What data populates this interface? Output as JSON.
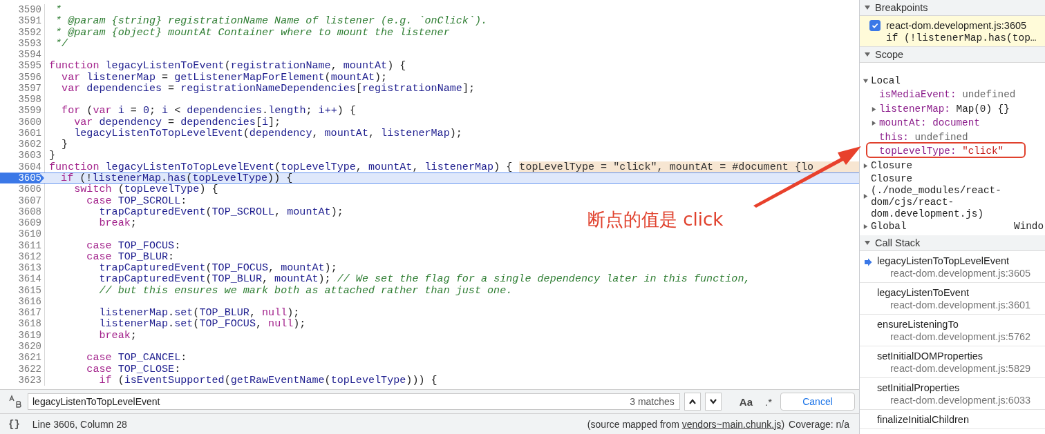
{
  "code": {
    "lines": [
      {
        "number": "3590",
        "paused": false,
        "tokens": [
          {
            "kind": "comment",
            "text": " *"
          }
        ]
      },
      {
        "number": "3591",
        "paused": false,
        "tokens": [
          {
            "kind": "comment",
            "text": " * @param {string} registrationName Name of listener (e.g. `onClick`)."
          }
        ]
      },
      {
        "number": "3592",
        "paused": false,
        "tokens": [
          {
            "kind": "comment",
            "text": " * @param {object} mountAt Container where to mount the listener"
          }
        ]
      },
      {
        "number": "3593",
        "paused": false,
        "tokens": [
          {
            "kind": "comment",
            "text": " */"
          }
        ]
      },
      {
        "number": "3594",
        "paused": false
      },
      {
        "number": "3595",
        "paused": false,
        "tokens": [
          {
            "kind": "keyword",
            "text": "function"
          },
          {
            "kind": "ident",
            "text": " legacyListenToEvent"
          },
          {
            "kind": "plain",
            "text": "("
          },
          {
            "kind": "ident",
            "text": "registrationName"
          },
          {
            "kind": "plain",
            "text": ", "
          },
          {
            "kind": "ident",
            "text": "mountAt"
          },
          {
            "kind": "plain",
            "text": ") {"
          }
        ]
      },
      {
        "number": "3596",
        "paused": false,
        "tokens": [
          {
            "kind": "keyword",
            "text": "  var"
          },
          {
            "kind": "ident",
            "text": " listenerMap"
          },
          {
            "kind": "plain",
            "text": " = "
          },
          {
            "kind": "ident",
            "text": "getListenerMapForElement"
          },
          {
            "kind": "plain",
            "text": "("
          },
          {
            "kind": "ident",
            "text": "mountAt"
          },
          {
            "kind": "plain",
            "text": ");"
          }
        ]
      },
      {
        "number": "3597",
        "paused": false,
        "tokens": [
          {
            "kind": "keyword",
            "text": "  var"
          },
          {
            "kind": "ident",
            "text": " dependencies"
          },
          {
            "kind": "plain",
            "text": " = "
          },
          {
            "kind": "ident",
            "text": "registrationNameDependencies"
          },
          {
            "kind": "plain",
            "text": "["
          },
          {
            "kind": "ident",
            "text": "registrationName"
          },
          {
            "kind": "plain",
            "text": "];"
          }
        ]
      },
      {
        "number": "3598",
        "paused": false
      },
      {
        "number": "3599",
        "paused": false,
        "tokens": [
          {
            "kind": "keyword",
            "text": "  for"
          },
          {
            "kind": "plain",
            "text": " ("
          },
          {
            "kind": "keyword",
            "text": "var"
          },
          {
            "kind": "ident",
            "text": " i"
          },
          {
            "kind": "plain",
            "text": " = "
          },
          {
            "kind": "ident",
            "text": "0"
          },
          {
            "kind": "plain",
            "text": "; "
          },
          {
            "kind": "ident",
            "text": "i"
          },
          {
            "kind": "plain",
            "text": " < "
          },
          {
            "kind": "ident",
            "text": "dependencies"
          },
          {
            "kind": "plain",
            "text": "."
          },
          {
            "kind": "ident",
            "text": "length"
          },
          {
            "kind": "plain",
            "text": "; "
          },
          {
            "kind": "ident",
            "text": "i++"
          },
          {
            "kind": "plain",
            "text": ") {"
          }
        ]
      },
      {
        "number": "3600",
        "paused": false,
        "tokens": [
          {
            "kind": "keyword",
            "text": "    var"
          },
          {
            "kind": "ident",
            "text": " dependency"
          },
          {
            "kind": "plain",
            "text": " = "
          },
          {
            "kind": "ident",
            "text": "dependencies"
          },
          {
            "kind": "plain",
            "text": "["
          },
          {
            "kind": "ident",
            "text": "i"
          },
          {
            "kind": "plain",
            "text": "];"
          }
        ]
      },
      {
        "number": "3601",
        "paused": false,
        "tokens": [
          {
            "kind": "match",
            "text": "    legacyListenToTopLevelEvent"
          },
          {
            "kind": "plain",
            "text": "("
          },
          {
            "kind": "ident",
            "text": "dependency"
          },
          {
            "kind": "plain",
            "text": ", "
          },
          {
            "kind": "ident",
            "text": "mountAt"
          },
          {
            "kind": "plain",
            "text": ", "
          },
          {
            "kind": "ident",
            "text": "listenerMap"
          },
          {
            "kind": "plain",
            "text": ");"
          }
        ]
      },
      {
        "number": "3602",
        "paused": false,
        "tokens": [
          {
            "kind": "plain",
            "text": "  }"
          }
        ]
      },
      {
        "number": "3603",
        "paused": false,
        "tokens": [
          {
            "kind": "plain",
            "text": "}"
          }
        ]
      },
      {
        "number": "3604",
        "paused": false,
        "tokens": [
          {
            "kind": "keyword",
            "text": "function"
          },
          {
            "kind": "match",
            "text": " legacyListenToTopLevelEvent"
          },
          {
            "kind": "plain",
            "text": "("
          },
          {
            "kind": "ident",
            "text": "topLevelType"
          },
          {
            "kind": "plain",
            "text": ", "
          },
          {
            "kind": "ident",
            "text": "mountAt"
          },
          {
            "kind": "plain",
            "text": ", "
          },
          {
            "kind": "ident",
            "text": "listenerMap"
          },
          {
            "kind": "plain",
            "text": ") {"
          }
        ],
        "inline_value": "topLevelType = \"click\", mountAt = #document {lo"
      },
      {
        "number": "3605",
        "paused": true,
        "tokens": [
          {
            "kind": "keyword",
            "text": "  if"
          },
          {
            "kind": "plain",
            "text": " (!"
          },
          {
            "kind": "ident",
            "text": "listenerMap"
          },
          {
            "kind": "plain",
            "text": "."
          },
          {
            "kind": "ident",
            "text": "has"
          },
          {
            "kind": "plain",
            "text": "("
          },
          {
            "kind": "ident",
            "text": "topLevelType"
          },
          {
            "kind": "plain",
            "text": ")) {"
          }
        ]
      },
      {
        "number": "3606",
        "paused": false,
        "tokens": [
          {
            "kind": "keyword",
            "text": "    switch"
          },
          {
            "kind": "plain",
            "text": " ("
          },
          {
            "kind": "ident",
            "text": "topLevelType"
          },
          {
            "kind": "plain",
            "text": ") {"
          }
        ]
      },
      {
        "number": "3607",
        "paused": false,
        "tokens": [
          {
            "kind": "keyword",
            "text": "      case"
          },
          {
            "kind": "ident",
            "text": " TOP_SCROLL"
          },
          {
            "kind": "plain",
            "text": ":"
          }
        ]
      },
      {
        "number": "3608",
        "paused": false,
        "tokens": [
          {
            "kind": "ident",
            "text": "        trapCapturedEvent"
          },
          {
            "kind": "plain",
            "text": "("
          },
          {
            "kind": "ident",
            "text": "TOP_SCROLL"
          },
          {
            "kind": "plain",
            "text": ", "
          },
          {
            "kind": "ident",
            "text": "mountAt"
          },
          {
            "kind": "plain",
            "text": ");"
          }
        ]
      },
      {
        "number": "3609",
        "paused": false,
        "tokens": [
          {
            "kind": "keyword",
            "text": "        break"
          },
          {
            "kind": "plain",
            "text": ";"
          }
        ]
      },
      {
        "number": "3610",
        "paused": false
      },
      {
        "number": "3611",
        "paused": false,
        "tokens": [
          {
            "kind": "keyword",
            "text": "      case"
          },
          {
            "kind": "ident",
            "text": " TOP_FOCUS"
          },
          {
            "kind": "plain",
            "text": ":"
          }
        ]
      },
      {
        "number": "3612",
        "paused": false,
        "tokens": [
          {
            "kind": "keyword",
            "text": "      case"
          },
          {
            "kind": "ident",
            "text": " TOP_BLUR"
          },
          {
            "kind": "plain",
            "text": ":"
          }
        ]
      },
      {
        "number": "3613",
        "paused": false,
        "tokens": [
          {
            "kind": "ident",
            "text": "        trapCapturedEvent"
          },
          {
            "kind": "plain",
            "text": "("
          },
          {
            "kind": "ident",
            "text": "TOP_FOCUS"
          },
          {
            "kind": "plain",
            "text": ", "
          },
          {
            "kind": "ident",
            "text": "mountAt"
          },
          {
            "kind": "plain",
            "text": ");"
          }
        ]
      },
      {
        "number": "3614",
        "paused": false,
        "tokens": [
          {
            "kind": "ident",
            "text": "        trapCapturedEvent"
          },
          {
            "kind": "plain",
            "text": "("
          },
          {
            "kind": "ident",
            "text": "TOP_BLUR"
          },
          {
            "kind": "plain",
            "text": ", "
          },
          {
            "kind": "ident",
            "text": "mountAt"
          },
          {
            "kind": "plain",
            "text": ");"
          },
          {
            "kind": "comment",
            "text": " // We set the flag for a single dependency later in this function,"
          }
        ]
      },
      {
        "number": "3615",
        "paused": false,
        "tokens": [
          {
            "kind": "comment",
            "text": "        // but this ensures we mark both as attached rather than just one."
          }
        ]
      },
      {
        "number": "3616",
        "paused": false
      },
      {
        "number": "3617",
        "paused": false,
        "tokens": [
          {
            "kind": "ident",
            "text": "        listenerMap"
          },
          {
            "kind": "plain",
            "text": "."
          },
          {
            "kind": "ident",
            "text": "set"
          },
          {
            "kind": "plain",
            "text": "("
          },
          {
            "kind": "ident",
            "text": "TOP_BLUR"
          },
          {
            "kind": "plain",
            "text": ", "
          },
          {
            "kind": "keyword",
            "text": "null"
          },
          {
            "kind": "plain",
            "text": ");"
          }
        ]
      },
      {
        "number": "3618",
        "paused": false,
        "tokens": [
          {
            "kind": "ident",
            "text": "        listenerMap"
          },
          {
            "kind": "plain",
            "text": "."
          },
          {
            "kind": "ident",
            "text": "set"
          },
          {
            "kind": "plain",
            "text": "("
          },
          {
            "kind": "ident",
            "text": "TOP_FOCUS"
          },
          {
            "kind": "plain",
            "text": ", "
          },
          {
            "kind": "keyword",
            "text": "null"
          },
          {
            "kind": "plain",
            "text": ");"
          }
        ]
      },
      {
        "number": "3619",
        "paused": false,
        "tokens": [
          {
            "kind": "keyword",
            "text": "        break"
          },
          {
            "kind": "plain",
            "text": ";"
          }
        ]
      },
      {
        "number": "3620",
        "paused": false
      },
      {
        "number": "3621",
        "paused": false,
        "tokens": [
          {
            "kind": "keyword",
            "text": "      case"
          },
          {
            "kind": "ident",
            "text": " TOP_CANCEL"
          },
          {
            "kind": "plain",
            "text": ":"
          }
        ]
      },
      {
        "number": "3622",
        "paused": false,
        "tokens": [
          {
            "kind": "keyword",
            "text": "      case"
          },
          {
            "kind": "ident",
            "text": " TOP_CLOSE"
          },
          {
            "kind": "plain",
            "text": ":"
          }
        ]
      },
      {
        "number": "3623",
        "paused": false,
        "tokens": [
          {
            "kind": "keyword",
            "text": "        if"
          },
          {
            "kind": "plain",
            "text": " ("
          },
          {
            "kind": "ident",
            "text": "isEventSupported"
          },
          {
            "kind": "plain",
            "text": "("
          },
          {
            "kind": "ident",
            "text": "getRawEventName"
          },
          {
            "kind": "plain",
            "text": "("
          },
          {
            "kind": "ident",
            "text": "topLevelType"
          },
          {
            "kind": "plain",
            "text": "))) {"
          }
        ]
      }
    ]
  },
  "search": {
    "value": "legacyListenToTopLevelEvent",
    "matches": "3 matches",
    "case_button": "Aa",
    "regex_button": ".*",
    "cancel_button": "Cancel"
  },
  "status_bar": {
    "icon_text": "{}",
    "position": "Line 3606, Column 28",
    "source_prefix": "(source mapped from ",
    "source_link": "vendors~main.chunk.js",
    "source_suffix": ")",
    "coverage": "Coverage: n/a"
  },
  "breakpoints": {
    "title": "Breakpoints",
    "expanded": true,
    "items": [
      {
        "checked": true,
        "location": "react-dom.development.js:3605",
        "code": "if (!listenerMap.has(top…"
      }
    ]
  },
  "scope": {
    "title": "Scope",
    "expanded": true,
    "items": [
      {
        "name": "Local",
        "expandable": true,
        "expanded": true,
        "children": [
          {
            "name": "isMediaEvent:",
            "value": "undefined",
            "kind": "undefined",
            "expandable": false,
            "expanded": false
          },
          {
            "name": "listenerMap:",
            "value": "Map(0) {}",
            "kind": "object",
            "expandable": true,
            "expanded": false
          },
          {
            "name": "mountAt:",
            "value": "document",
            "kind": "node",
            "expandable": true,
            "expanded": false
          },
          {
            "name": "this:",
            "value": "undefined",
            "kind": "undefined",
            "expandable": false,
            "expanded": false
          },
          {
            "name": "topLevelType:",
            "value": "\"click\"",
            "kind": "string",
            "expandable": false,
            "expanded": false
          }
        ]
      },
      {
        "name": "Closure",
        "expandable": true,
        "expanded": false
      },
      {
        "name": "Closure (./node_modules/react-dom/cjs/react-dom.development.js)",
        "expandable": true,
        "expanded": false
      },
      {
        "name": "Global",
        "value": "Windo",
        "expandable": true,
        "expanded": false
      }
    ]
  },
  "call_stack": {
    "title": "Call Stack",
    "expanded": true,
    "frames": [
      {
        "function": "legacyListenToTopLevelEvent",
        "location": "react-dom.development.js:3605",
        "selected": true
      },
      {
        "function": "legacyListenToEvent",
        "location": "react-dom.development.js:3601",
        "selected": false
      },
      {
        "function": "ensureListeningTo",
        "location": "react-dom.development.js:5762",
        "selected": false
      },
      {
        "function": "setInitialDOMProperties",
        "location": "react-dom.development.js:5829",
        "selected": false
      },
      {
        "function": "setInitialProperties",
        "location": "react-dom.development.js:6033",
        "selected": false
      },
      {
        "function": "finalizeInitialChildren",
        "selected": false
      }
    ]
  },
  "annotation": {
    "text": "断点的值是 click"
  }
}
